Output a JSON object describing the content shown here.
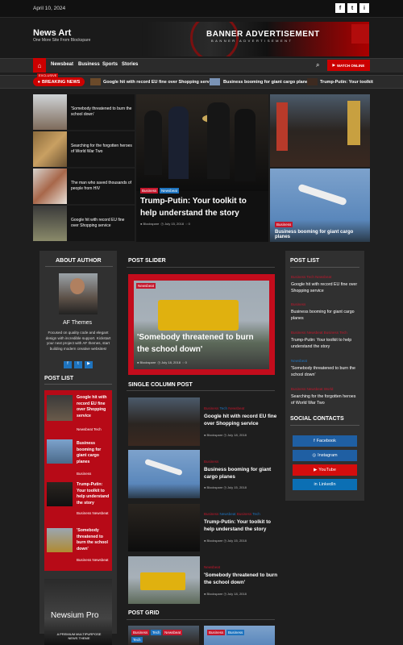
{
  "topbar": {
    "date": "April 10, 2024",
    "social": [
      "f",
      "t",
      "i"
    ]
  },
  "header": {
    "site_title": "News Art",
    "tagline": "One More Site From Blockspare",
    "banner_title": "BANNER ADVERTISEMENT",
    "banner_sub": "BANNER ADVERTISEMENT"
  },
  "nav": {
    "home_icon": "home-icon",
    "items": [
      "Newsbeat",
      "Business",
      "Sports",
      "Stories"
    ],
    "watch_label": "WATCH ONLINE"
  },
  "ticker": {
    "exclusive": "EXCLUSIVE",
    "label": "BREAKING NEWS",
    "items": [
      "Google hit with record EU fine over Shopping service",
      "Business booming for giant cargo planes",
      "Trump-Putin: Your toolkit"
    ]
  },
  "top_list": [
    "'Somebody threatened to burn the school down'",
    "Searching for the forgotten heroes of World War Two",
    "The man who saved thousands of people from HIV",
    "Google hit with record EU fine over Shopping service"
  ],
  "feature": {
    "cats": [
      "Business",
      "Newsbeat"
    ],
    "title": "Trump-Putin: Your toolkit to help understand the story",
    "author": "Blockspare",
    "date": "July 15, 2018",
    "comments": "0"
  },
  "right_top": {
    "cat": "Business",
    "title": "Business booming for giant cargo planes"
  },
  "about": {
    "title": "ABOUT AUTHOR",
    "name": "AF Themes",
    "desc": "Focused on quality code and elegant design with incredible support. Kickstart your next project with AF themes, start building modern creative websites!"
  },
  "post_list_left": {
    "title": "POST LIST",
    "items": [
      {
        "title": "Google hit with record EU fine over Shopping service",
        "cats": "Newsbeat Tech"
      },
      {
        "title": "Business booming for giant cargo planes",
        "cats": "Business"
      },
      {
        "title": "Trump-Putin: Your toolkit to help understand the story",
        "cats": "Business Newsbeat"
      },
      {
        "title": "'Somebody threatened to burn the school down'",
        "cats": "Business Newsbeat"
      }
    ]
  },
  "promo": {
    "title": "Newsium Pro",
    "sub": "A PREMIUM MULTIPURPOSE NEWS THEME"
  },
  "post_slider": {
    "title": "POST SLIDER",
    "cat": "Newsbeat",
    "headline": "'Somebody threatened to burn the school down'",
    "author": "Blockspare",
    "date": "July 18, 2018",
    "comments": "0"
  },
  "single_column": {
    "title": "SINGLE COLUMN POST",
    "items": [
      {
        "cats": [
          "Business",
          "Tech",
          "Newsbeat"
        ],
        "title": "Google hit with record EU fine over Shopping service",
        "author": "Blockspare",
        "date": "July 18, 2018"
      },
      {
        "cats": [
          "Business"
        ],
        "title": "Business booming for giant cargo planes",
        "author": "Blockspare",
        "date": "July 15, 2018"
      },
      {
        "cats": [
          "Business",
          "Newsbeat",
          "Business",
          "Tech"
        ],
        "title": "Trump-Putin: Your toolkit to help understand the story",
        "author": "Blockspare",
        "date": "July 15, 2018"
      },
      {
        "cats": [
          "Newsbeat"
        ],
        "title": "'Somebody threatened to burn the school down'",
        "author": "Blockspare",
        "date": "July 18, 2018"
      }
    ]
  },
  "post_grid": {
    "title": "POST GRID",
    "cats_a": [
      "Business",
      "Tech",
      "Newsbeat"
    ],
    "cats_a2": [
      "Tech"
    ],
    "cats_b": [
      "Business",
      "Business"
    ]
  },
  "post_list_right": {
    "title": "POST LIST",
    "items": [
      {
        "cats": "Business Tech Newsbeat",
        "title": "Google hit with record EU fine over Shopping service"
      },
      {
        "cats": "Business",
        "title": "Business booming for giant cargo planes"
      },
      {
        "cats": "Business Newsbeat Business Tech",
        "title": "Trump-Putin: Your toolkit to help understand the story"
      },
      {
        "cats": "Newsbeat",
        "title": "'Somebody threatened to burn the school down'"
      },
      {
        "cats": "Business Newsbeat World",
        "title": "Searching for the forgotten heroes of World War Two"
      }
    ]
  },
  "social_contacts": {
    "title": "SOCIAL CONTACTS",
    "buttons": [
      {
        "label": "Facebook",
        "color": "#1f5fa3"
      },
      {
        "label": "Instagram",
        "color": "#1f5fa3"
      },
      {
        "label": "YouTube",
        "color": "#d40d0d"
      },
      {
        "label": "LinkedIn",
        "color": "#0b6fb4"
      }
    ]
  },
  "colors": {
    "accent": "#cc0000",
    "category_red": "#c3172c",
    "category_blue": "#1e73be"
  }
}
